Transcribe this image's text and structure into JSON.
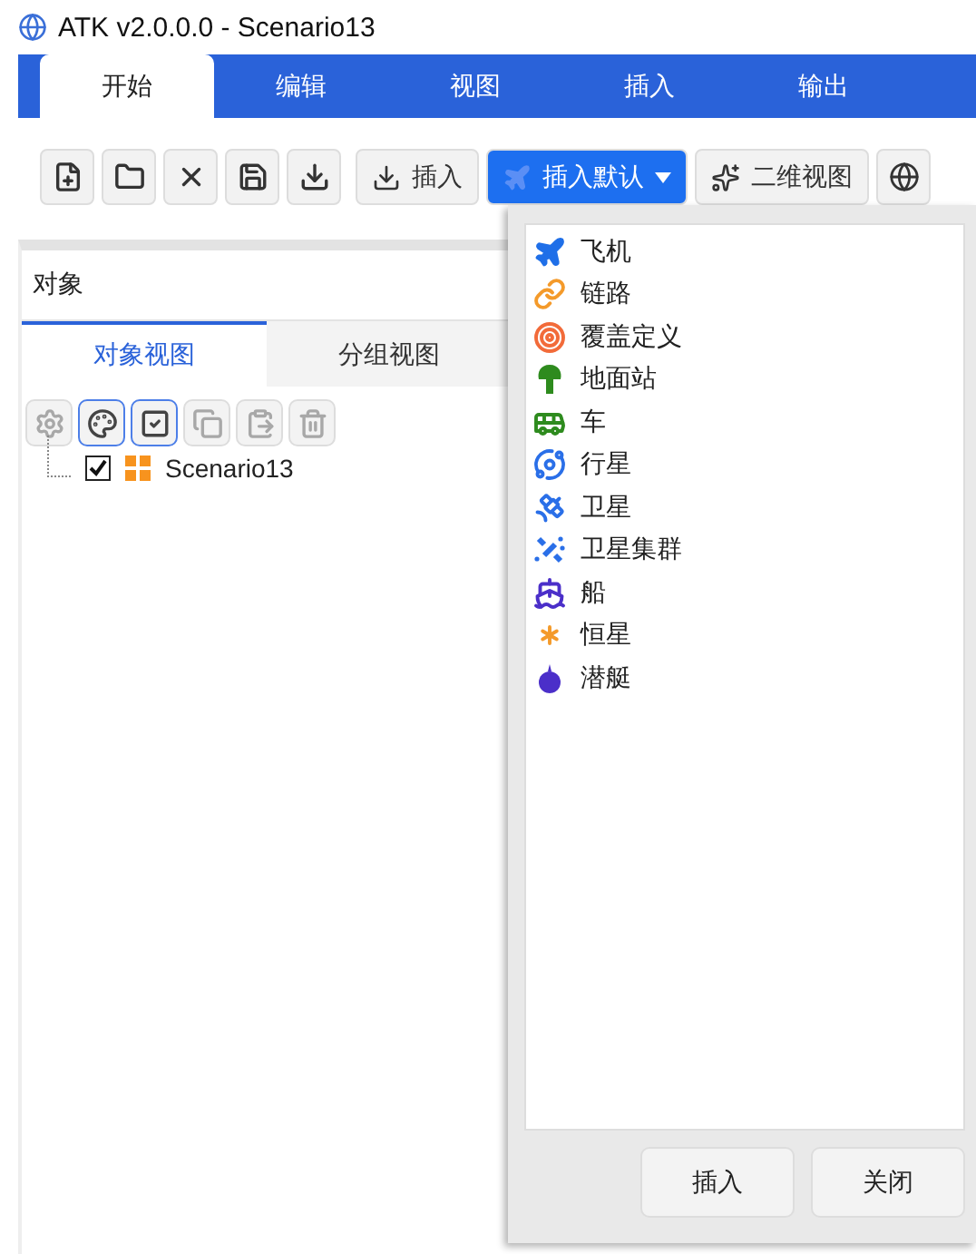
{
  "window": {
    "title": "ATK v2.0.0.0 - Scenario13"
  },
  "ribbon_tabs": [
    {
      "label": "开始",
      "selected": true
    },
    {
      "label": "编辑",
      "selected": false
    },
    {
      "label": "视图",
      "selected": false
    },
    {
      "label": "插入",
      "selected": false
    },
    {
      "label": "输出",
      "selected": false
    }
  ],
  "toolbar": {
    "file_buttons": [
      {
        "kind": "new"
      },
      {
        "kind": "open"
      },
      {
        "kind": "close"
      },
      {
        "kind": "save"
      },
      {
        "kind": "save_as"
      }
    ],
    "insert_button": {
      "label": "插入"
    },
    "insert_default_button": {
      "label": "插入默认",
      "expanded": true
    },
    "view_2d_button": {
      "label": "二维视图"
    }
  },
  "objects_panel": {
    "title": "对象",
    "tabs": [
      {
        "label": "对象视图",
        "selected": true
      },
      {
        "label": "分组视图",
        "selected": false
      }
    ],
    "tools": [
      {
        "kind": "settings",
        "selected": false,
        "disabled": true
      },
      {
        "kind": "palette",
        "selected": true,
        "disabled": false
      },
      {
        "kind": "check",
        "selected": true,
        "disabled": false
      },
      {
        "kind": "copy",
        "selected": false,
        "disabled": true
      },
      {
        "kind": "paste",
        "selected": false,
        "disabled": true
      },
      {
        "kind": "delete",
        "selected": false,
        "disabled": true
      }
    ],
    "tree": [
      {
        "label": "Scenario13",
        "checked": true
      }
    ]
  },
  "insert_popup": {
    "items": [
      {
        "label": "飞机",
        "kind": "aircraft"
      },
      {
        "label": "链路",
        "kind": "link"
      },
      {
        "label": "覆盖定义",
        "kind": "coverage"
      },
      {
        "label": "地面站",
        "kind": "ground_station"
      },
      {
        "label": "车",
        "kind": "vehicle"
      },
      {
        "label": "行星",
        "kind": "planet"
      },
      {
        "label": "卫星",
        "kind": "satellite"
      },
      {
        "label": "卫星集群",
        "kind": "constellation"
      },
      {
        "label": "船",
        "kind": "ship"
      },
      {
        "label": "恒星",
        "kind": "star"
      },
      {
        "label": "潜艇",
        "kind": "submarine"
      }
    ],
    "buttons": [
      {
        "label": "插入"
      },
      {
        "label": "关闭"
      }
    ]
  }
}
